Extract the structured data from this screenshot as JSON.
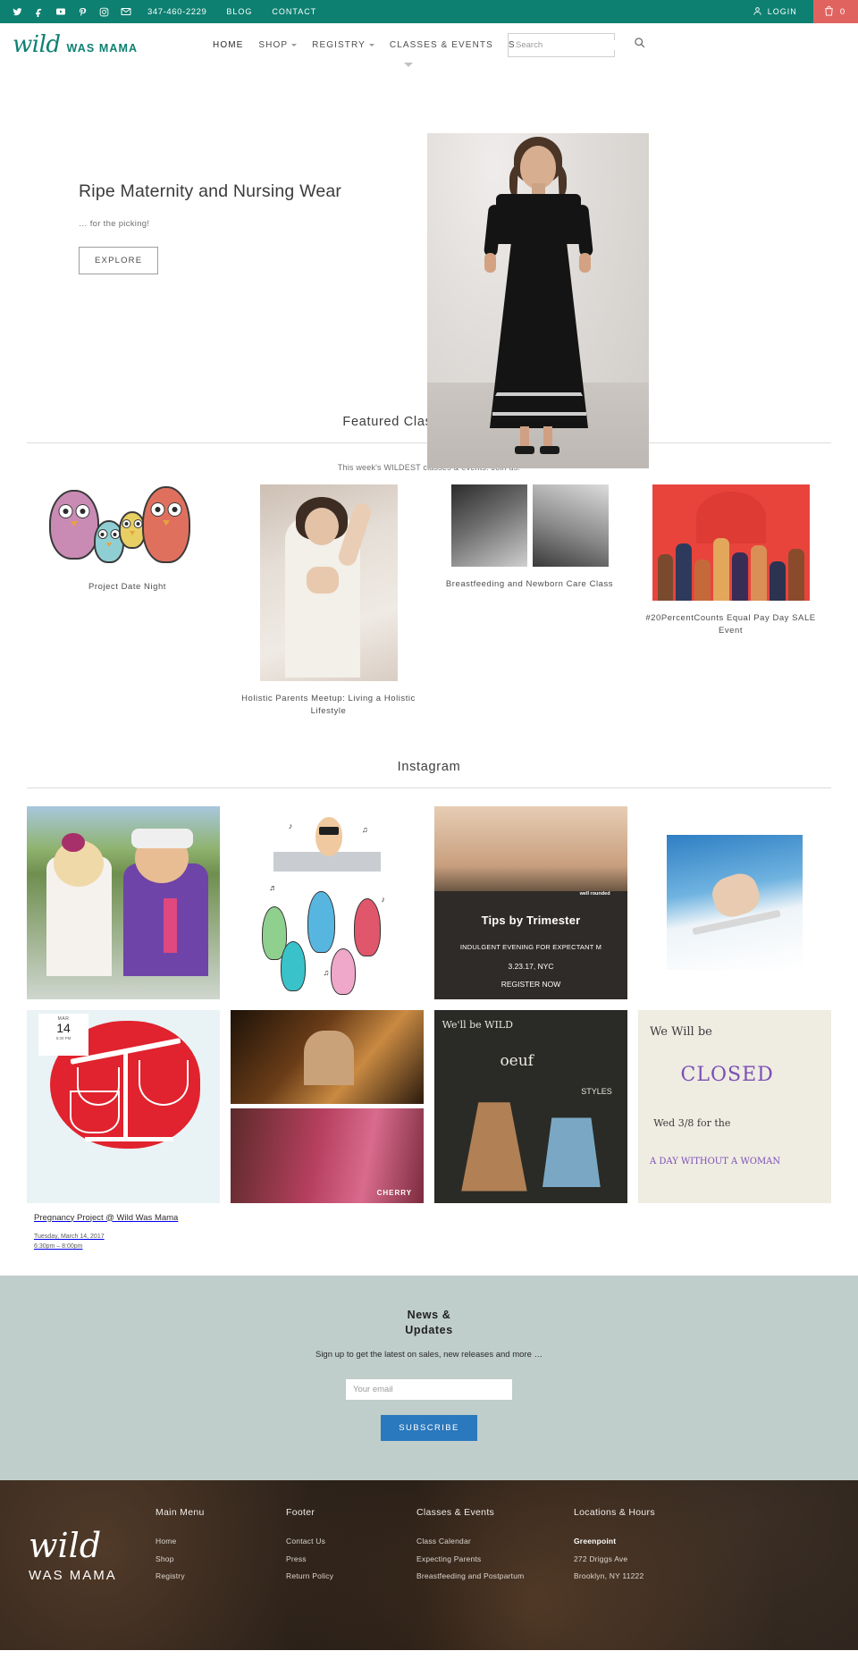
{
  "topbar": {
    "social": [
      {
        "name": "twitter-icon",
        "label": "Twitter"
      },
      {
        "name": "facebook-icon",
        "label": "Facebook"
      },
      {
        "name": "youtube-icon",
        "label": "YouTube"
      },
      {
        "name": "pinterest-icon",
        "label": "Pinterest"
      },
      {
        "name": "instagram-icon",
        "label": "Instagram"
      },
      {
        "name": "email-icon",
        "label": "Email"
      }
    ],
    "phone": "347-460-2229",
    "blog": "BLOG",
    "contact": "CONTACT",
    "login": "LOGIN",
    "cart_count": "0",
    "bar_color": "#0d8071",
    "cart_color": "#e0635f"
  },
  "brand": {
    "word1": "wild",
    "word2": "WAS MAMA"
  },
  "nav": {
    "items": [
      {
        "label": "HOME",
        "caret": false
      },
      {
        "label": "SHOP",
        "caret": true
      },
      {
        "label": "REGISTRY",
        "caret": true
      },
      {
        "label": "CLASSES & EVENTS",
        "caret": false
      },
      {
        "label": "SALE",
        "caret": true
      }
    ]
  },
  "search": {
    "placeholder": "Search",
    "value": ""
  },
  "hero": {
    "title": "Ripe Maternity and Nursing Wear",
    "subtitle": "… for the picking!",
    "button": "EXPLORE"
  },
  "featured": {
    "title": "Featured Classes & Events",
    "subtitle": "This week's WILDEST classes & events! Join us!",
    "items": [
      {
        "name": "Project Date Night"
      },
      {
        "name": "Holistic Parents Meetup: Living a Holistic Lifestyle"
      },
      {
        "name": "Breastfeeding and Newborn Care Class"
      },
      {
        "name": "#20PercentCounts Equal Pay Day SALE Event"
      }
    ]
  },
  "instagram": {
    "title": "Instagram",
    "posts": [
      {
        "caption": ""
      },
      {
        "caption": ""
      },
      {
        "overlay_brand": "well rounded",
        "overlay_title": "Tips by Trimester",
        "overlay_line2": "INDULGENT EVENING FOR EXPECTANT M",
        "overlay_line3": "3.23.17, NYC",
        "overlay_line4": "REGISTER NOW"
      },
      {
        "caption": ""
      },
      {
        "date_month": "MAR",
        "date_day": "14",
        "date_time": "6:30 PM",
        "title": "Pregnancy Project @ Wild Was Mama",
        "date_line": "Tuesday, March 14, 2017",
        "time_line": "6:30pm – 8:00pm"
      },
      {
        "caption": "CHERRY"
      },
      {
        "chalk_top": "We'll be WILD",
        "chalk_word": "oeuf",
        "chalk_styles": "STYLES"
      },
      {
        "l1": "We Will be",
        "l2": "CLOSED",
        "l3": "Wed 3/8 for the",
        "l4": "A DAY WITHOUT A WOMAN"
      }
    ]
  },
  "newsletter": {
    "title_line1": "News &",
    "title_line2": "Updates",
    "description": "Sign up to get the latest on sales, new releases and more …",
    "placeholder": "Your email",
    "button": "SUBSCRIBE",
    "bg_color": "#bfcdcb",
    "button_color": "#2a78bd"
  },
  "footer": {
    "brand_word1": "wild",
    "brand_word2": "WAS MAMA",
    "columns": [
      {
        "heading": "Main Menu",
        "links": [
          "Home",
          "Shop",
          "Registry"
        ]
      },
      {
        "heading": "Footer",
        "links": [
          "Contact Us",
          "Press",
          "Return Policy"
        ]
      },
      {
        "heading": "Classes & Events",
        "links": [
          "Class Calendar",
          "Expecting Parents",
          "Breastfeeding and Postpartum"
        ]
      },
      {
        "heading": "Locations & Hours",
        "links": [
          "Greenpoint",
          "272 Driggs Ave",
          "Brooklyn, NY 11222"
        ]
      }
    ]
  }
}
